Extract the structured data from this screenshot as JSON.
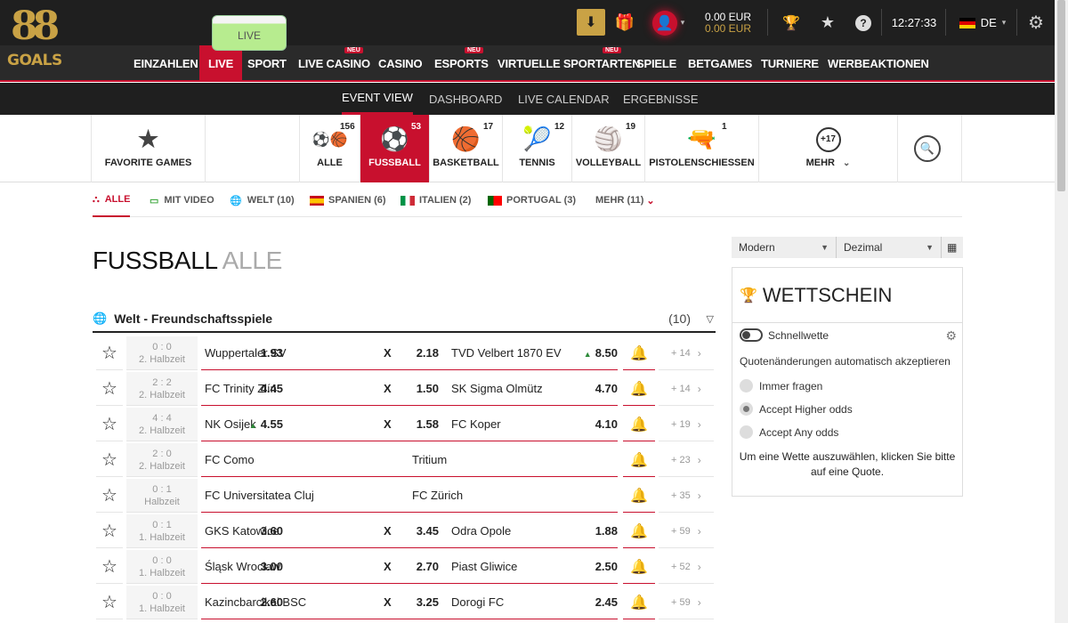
{
  "logo": {
    "top": "88",
    "bottom": "GOALS"
  },
  "topbar": {
    "download_icon": "⬇",
    "gift_icon": "🎁",
    "user_icon": "👤",
    "balance_main": "0.00 EUR",
    "balance_bonus": "0.00 EUR",
    "trophy_icon": "🏆",
    "favorites_icon": "★",
    "help_label": "?",
    "time": "12:27:33",
    "language": "DE",
    "settings_icon": "⚙"
  },
  "mainnav": {
    "items": [
      "EINZAHLEN",
      "LIVE",
      "SPORT",
      "LIVE CASINO",
      "CASINO",
      "ESPORTS",
      "VIRTUELLE SPORTARTEN",
      "SPIELE",
      "BETGAMES",
      "TURNIERE",
      "WERBEAKTIONEN"
    ],
    "neu": "NEU"
  },
  "subnav": {
    "items": [
      "EVENT VIEW",
      "DASHBOARD",
      "LIVE CALENDAR",
      "ERGEBNISSE"
    ]
  },
  "sports": {
    "favorite": "FAVORITE GAMES",
    "live": "LIVE",
    "items": [
      {
        "label": "ALLE",
        "count": "156"
      },
      {
        "label": "FUSSBALL",
        "count": "53"
      },
      {
        "label": "BASKETBALL",
        "count": "17"
      },
      {
        "label": "TENNIS",
        "count": "12"
      },
      {
        "label": "VOLLEYBALL",
        "count": "19"
      },
      {
        "label": "PISTOLENSCHIESSEN",
        "count": "1"
      }
    ],
    "more_badge": "+17",
    "more_label": "MEHR"
  },
  "filters": {
    "items": [
      "ALLE",
      "MIT VIDEO",
      "WELT  (10)",
      "SPANIEN  (6)",
      "ITALIEN  (2)",
      "PORTUGAL  (3)"
    ],
    "more": "MEHR (11)"
  },
  "page": {
    "title": "FUSSBALL",
    "subtitle": "ALLE"
  },
  "group": {
    "title": "Welt - Freundschaftsspiele",
    "count": "(10)"
  },
  "matches": [
    {
      "score": "0 : 0",
      "period": "2. Halbzeit",
      "home": "Wuppertaler SV",
      "o1": "1.93",
      "x": "X",
      "o2": "2.18",
      "away": "TVD Velbert 1870 EV",
      "o3": "8.50",
      "up3": true,
      "more": "+ 14"
    },
    {
      "score": "2 : 2",
      "period": "2. Halbzeit",
      "home": "FC Trinity Zlín",
      "o1": "4.45",
      "x": "X",
      "o2": "1.50",
      "away": "SK Sigma Olmütz",
      "o3": "4.70",
      "more": "+ 14"
    },
    {
      "score": "4 : 4",
      "period": "2. Halbzeit",
      "home": "NK Osijek",
      "o1": "4.55",
      "up1": true,
      "x": "X",
      "o2": "1.58",
      "away": "FC Koper",
      "o3": "4.10",
      "more": "+ 19"
    },
    {
      "score": "2 : 0",
      "period": "2. Halbzeit",
      "home": "FC Como",
      "o1": "",
      "x": "",
      "o2": "",
      "away": "Tritium",
      "o3": "",
      "more": "+ 23"
    },
    {
      "score": "0 : 1",
      "period": "Halbzeit",
      "home": "FC Universitatea Cluj",
      "o1": "",
      "x": "",
      "o2": "",
      "away": "FC Zürich",
      "o3": "",
      "more": "+ 35"
    },
    {
      "score": "0 : 1",
      "period": "1. Halbzeit",
      "home": "GKS Katowice",
      "o1": "3.60",
      "x": "X",
      "o2": "3.45",
      "away": "Odra Opole",
      "o3": "1.88",
      "more": "+ 59"
    },
    {
      "score": "0 : 0",
      "period": "1. Halbzeit",
      "home": "Śląsk Wrocław",
      "o1": "3.00",
      "x": "X",
      "o2": "2.70",
      "away": "Piast Gliwice",
      "o3": "2.50",
      "more": "+ 52"
    },
    {
      "score": "0 : 0",
      "period": "1. Halbzeit",
      "home": "Kazincbarcikai BSC",
      "o1": "2.60",
      "x": "X",
      "o2": "3.25",
      "away": "Dorogi FC",
      "o3": "2.45",
      "more": "+ 59"
    }
  ],
  "odds_format": {
    "style": "Modern",
    "format": "Dezimal"
  },
  "betslip": {
    "title": "WETTSCHEIN",
    "quickbet": "Schnellwette",
    "odds_change": "Quotenänderungen automatisch akzeptieren",
    "options": [
      "Immer fragen",
      "Accept Higher odds",
      "Accept Any odds"
    ],
    "selected_option": 1,
    "hint": "Um eine Wette auszuwählen, klicken Sie bitte auf eine Quote."
  },
  "colors": {
    "accent": "#c8102e",
    "gold": "#c9a245",
    "dark": "#1f1f1f"
  }
}
